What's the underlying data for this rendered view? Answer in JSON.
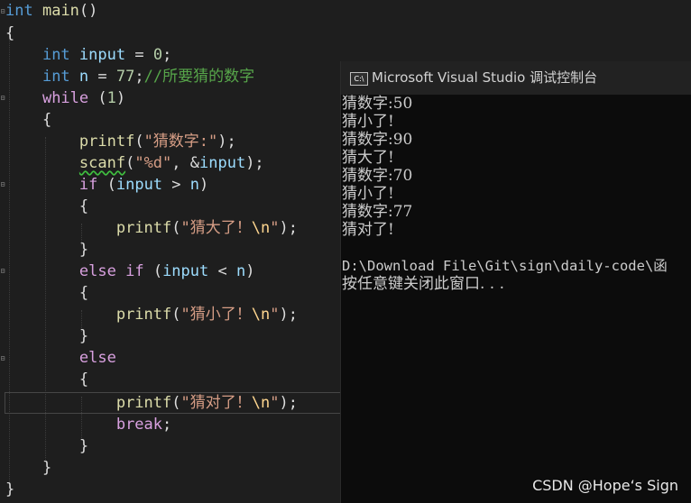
{
  "editor": {
    "lines": [
      {
        "id": "l1",
        "parts": [
          [
            "kw",
            "int"
          ],
          [
            "plain",
            " "
          ],
          [
            "fn",
            "main"
          ],
          [
            "plain",
            "()"
          ]
        ]
      },
      {
        "id": "l2",
        "parts": [
          [
            "plain",
            "{"
          ]
        ]
      },
      {
        "id": "l3",
        "parts": [
          [
            "plain",
            "    "
          ],
          [
            "kw",
            "int"
          ],
          [
            "plain",
            " "
          ],
          [
            "id",
            "input"
          ],
          [
            "plain",
            " = "
          ],
          [
            "num",
            "0"
          ],
          [
            "plain",
            ";"
          ]
        ]
      },
      {
        "id": "l4",
        "parts": [
          [
            "plain",
            "    "
          ],
          [
            "kw",
            "int"
          ],
          [
            "plain",
            " "
          ],
          [
            "id",
            "n"
          ],
          [
            "plain",
            " = "
          ],
          [
            "num",
            "77"
          ],
          [
            "plain",
            ";"
          ],
          [
            "com",
            "//所要猜的数字"
          ]
        ]
      },
      {
        "id": "l5",
        "parts": [
          [
            "plain",
            "    "
          ],
          [
            "ctl",
            "while"
          ],
          [
            "plain",
            " ("
          ],
          [
            "num",
            "1"
          ],
          [
            "plain",
            ")"
          ]
        ]
      },
      {
        "id": "l6",
        "parts": [
          [
            "plain",
            "    {"
          ]
        ]
      },
      {
        "id": "l7",
        "parts": [
          [
            "plain",
            "        "
          ],
          [
            "fn",
            "printf"
          ],
          [
            "plain",
            "("
          ],
          [
            "str",
            "\"猜数字:\""
          ],
          [
            "plain",
            ");"
          ]
        ]
      },
      {
        "id": "l8",
        "parts": [
          [
            "plain",
            "        "
          ],
          [
            "fnsq",
            "scanf"
          ],
          [
            "plain",
            "("
          ],
          [
            "str",
            "\"%d\""
          ],
          [
            "plain",
            ", &"
          ],
          [
            "id",
            "input"
          ],
          [
            "plain",
            ");"
          ]
        ]
      },
      {
        "id": "l9",
        "parts": [
          [
            "plain",
            "        "
          ],
          [
            "ctl",
            "if"
          ],
          [
            "plain",
            " ("
          ],
          [
            "id",
            "input"
          ],
          [
            "plain",
            " > "
          ],
          [
            "id",
            "n"
          ],
          [
            "plain",
            ")"
          ]
        ]
      },
      {
        "id": "l10",
        "parts": [
          [
            "plain",
            "        {"
          ]
        ]
      },
      {
        "id": "l11",
        "parts": [
          [
            "plain",
            "            "
          ],
          [
            "fn",
            "printf"
          ],
          [
            "plain",
            "("
          ],
          [
            "str",
            "\"猜大了！"
          ],
          [
            "esc",
            "\\n"
          ],
          [
            "str",
            "\""
          ],
          [
            "plain",
            ");"
          ]
        ]
      },
      {
        "id": "l12",
        "parts": [
          [
            "plain",
            "        }"
          ]
        ]
      },
      {
        "id": "l13",
        "parts": [
          [
            "plain",
            "        "
          ],
          [
            "ctl",
            "else"
          ],
          [
            "plain",
            " "
          ],
          [
            "ctl",
            "if"
          ],
          [
            "plain",
            " ("
          ],
          [
            "id",
            "input"
          ],
          [
            "plain",
            " < "
          ],
          [
            "id",
            "n"
          ],
          [
            "plain",
            ")"
          ]
        ]
      },
      {
        "id": "l14",
        "parts": [
          [
            "plain",
            "        {"
          ]
        ]
      },
      {
        "id": "l15",
        "parts": [
          [
            "plain",
            "            "
          ],
          [
            "fn",
            "printf"
          ],
          [
            "plain",
            "("
          ],
          [
            "str",
            "\"猜小了！"
          ],
          [
            "esc",
            "\\n"
          ],
          [
            "str",
            "\""
          ],
          [
            "plain",
            ");"
          ]
        ]
      },
      {
        "id": "l16",
        "parts": [
          [
            "plain",
            "        }"
          ]
        ]
      },
      {
        "id": "l17",
        "parts": [
          [
            "plain",
            "        "
          ],
          [
            "ctl",
            "else"
          ]
        ]
      },
      {
        "id": "l18",
        "parts": [
          [
            "plain",
            "        {"
          ]
        ]
      },
      {
        "id": "l19",
        "parts": [
          [
            "plain",
            "            "
          ],
          [
            "fn",
            "printf"
          ],
          [
            "plain",
            "("
          ],
          [
            "str",
            "\"猜对了！"
          ],
          [
            "esc",
            "\\n"
          ],
          [
            "str",
            "\""
          ],
          [
            "plain",
            ");"
          ]
        ]
      },
      {
        "id": "l20",
        "parts": [
          [
            "plain",
            "            "
          ],
          [
            "ctl",
            "break"
          ],
          [
            "plain",
            ";"
          ]
        ]
      },
      {
        "id": "l21",
        "parts": [
          [
            "plain",
            "        }"
          ]
        ]
      },
      {
        "id": "l22",
        "parts": [
          [
            "plain",
            "    }"
          ]
        ]
      },
      {
        "id": "l23",
        "parts": [
          [
            "plain",
            "}"
          ]
        ]
      }
    ]
  },
  "console": {
    "title": "Microsoft Visual Studio 调试控制台",
    "icon_label": "C:\\",
    "output": [
      "猜数字:50",
      "猜小了!",
      "猜数字:90",
      "猜大了!",
      "猜数字:70",
      "猜小了!",
      "猜数字:77",
      "猜对了!",
      "",
      "D:\\Download File\\Git\\sign\\daily-code\\函",
      "按任意键关闭此窗口. . ."
    ]
  },
  "watermark": "CSDN @Hope‘s Sign"
}
